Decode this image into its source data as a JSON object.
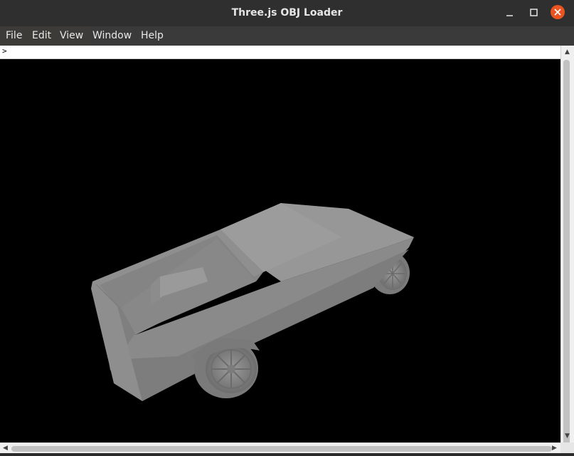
{
  "window": {
    "title": "Three.js OBJ Loader"
  },
  "menubar": {
    "items": [
      "File",
      "Edit",
      "View",
      "Window",
      "Help"
    ]
  },
  "console": {
    "prompt": ">"
  },
  "viewport": {
    "background": "#000000",
    "model_color": "#8c8c8c"
  },
  "colors": {
    "titlebar": "#2f2f2f",
    "menubar": "#3c3b37",
    "close_button": "#e95420"
  }
}
